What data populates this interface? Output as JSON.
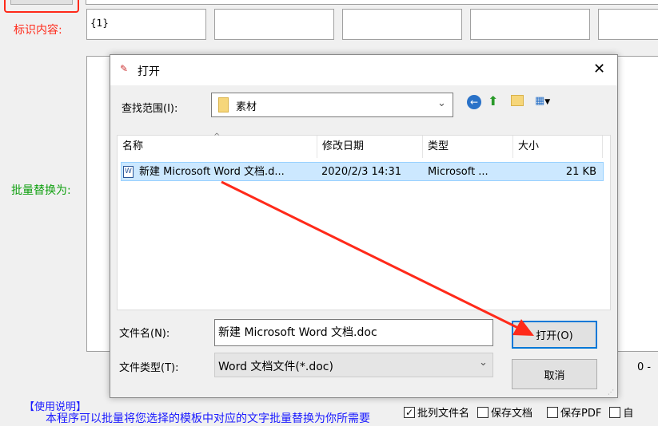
{
  "main": {
    "marker_label": "标识内容:",
    "marker_values": [
      "{1}",
      "",
      "",
      "",
      ""
    ],
    "replace_label": "批量替换为:",
    "range_text": "0 -",
    "help_title": "【使用说明】",
    "help_text": "本程序可以批量将您选择的模板中对应的文字批量替换为你所需要",
    "checkboxes": [
      {
        "label": "批列文件名",
        "checked": true
      },
      {
        "label": "保存文档",
        "checked": false
      },
      {
        "label": "保存PDF",
        "checked": false
      },
      {
        "label": "自",
        "checked": false
      }
    ]
  },
  "dialog": {
    "title": "打开",
    "lookin_label": "查找范围(I):",
    "lookin_value": "素材",
    "columns": [
      "名称",
      "修改日期",
      "类型",
      "大小"
    ],
    "files": [
      {
        "name": "新建 Microsoft Word 文档.d...",
        "modified": "2020/2/3 14:31",
        "type": "Microsoft ...",
        "size": "21 KB"
      }
    ],
    "filename_label": "文件名(N):",
    "filename_value": "新建 Microsoft Word 文档.doc",
    "filetype_label": "文件类型(T):",
    "filetype_value": "Word 文档文件(*.doc)",
    "open_label": "打开(O)",
    "cancel_label": "取消"
  },
  "colors": {
    "red": "#ff2a1a",
    "green": "#10a010",
    "blue": "#1a1aff",
    "select": "#cce8ff"
  }
}
